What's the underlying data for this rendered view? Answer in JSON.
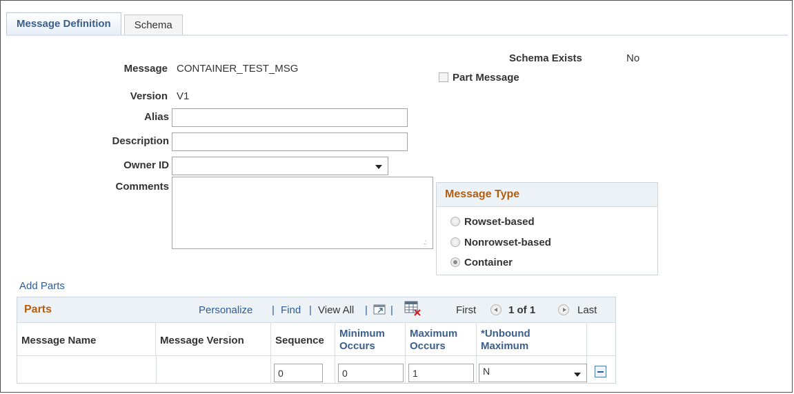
{
  "tabs": [
    {
      "label": "Message Definition",
      "active": true
    },
    {
      "label": "Schema",
      "active": false
    }
  ],
  "form": {
    "message_label": "Message",
    "message_value": "CONTAINER_TEST_MSG",
    "version_label": "Version",
    "version_value": "V1",
    "alias_label": "Alias",
    "alias_value": "",
    "description_label": "Description",
    "description_value": "",
    "owner_label": "Owner ID",
    "owner_value": "",
    "comments_label": "Comments",
    "comments_value": "",
    "schema_exists_label": "Schema Exists",
    "schema_exists_value": "No",
    "part_message_label": "Part Message",
    "part_message_checked": false
  },
  "message_type": {
    "title": "Message Type",
    "options": [
      {
        "label": "Rowset-based",
        "selected": false
      },
      {
        "label": "Nonrowset-based",
        "selected": false
      },
      {
        "label": "Container",
        "selected": true
      }
    ]
  },
  "add_parts_label": "Add Parts",
  "grid": {
    "title": "Parts",
    "personalize": "Personalize",
    "find": "Find",
    "view_all": "View All",
    "first": "First",
    "page": "1 of 1",
    "last": "Last",
    "columns": [
      {
        "line1": "Message Name",
        "line2": ""
      },
      {
        "line1": "Message Version",
        "line2": ""
      },
      {
        "line1": "Sequence",
        "line2": ""
      },
      {
        "line1": "Minimum",
        "line2": "Occurs"
      },
      {
        "line1": "Maximum",
        "line2": "Occurs"
      },
      {
        "line1": "*Unbound",
        "line2": "Maximum"
      }
    ],
    "rows": [
      {
        "message_name": "",
        "message_version": "",
        "sequence": "0",
        "min_occurs": "0",
        "max_occurs": "1",
        "unbound_max": "N"
      }
    ]
  },
  "colors": {
    "accent": "#b55d0e",
    "link": "#2a5d9c",
    "tab_text": "#3b5f8a"
  }
}
